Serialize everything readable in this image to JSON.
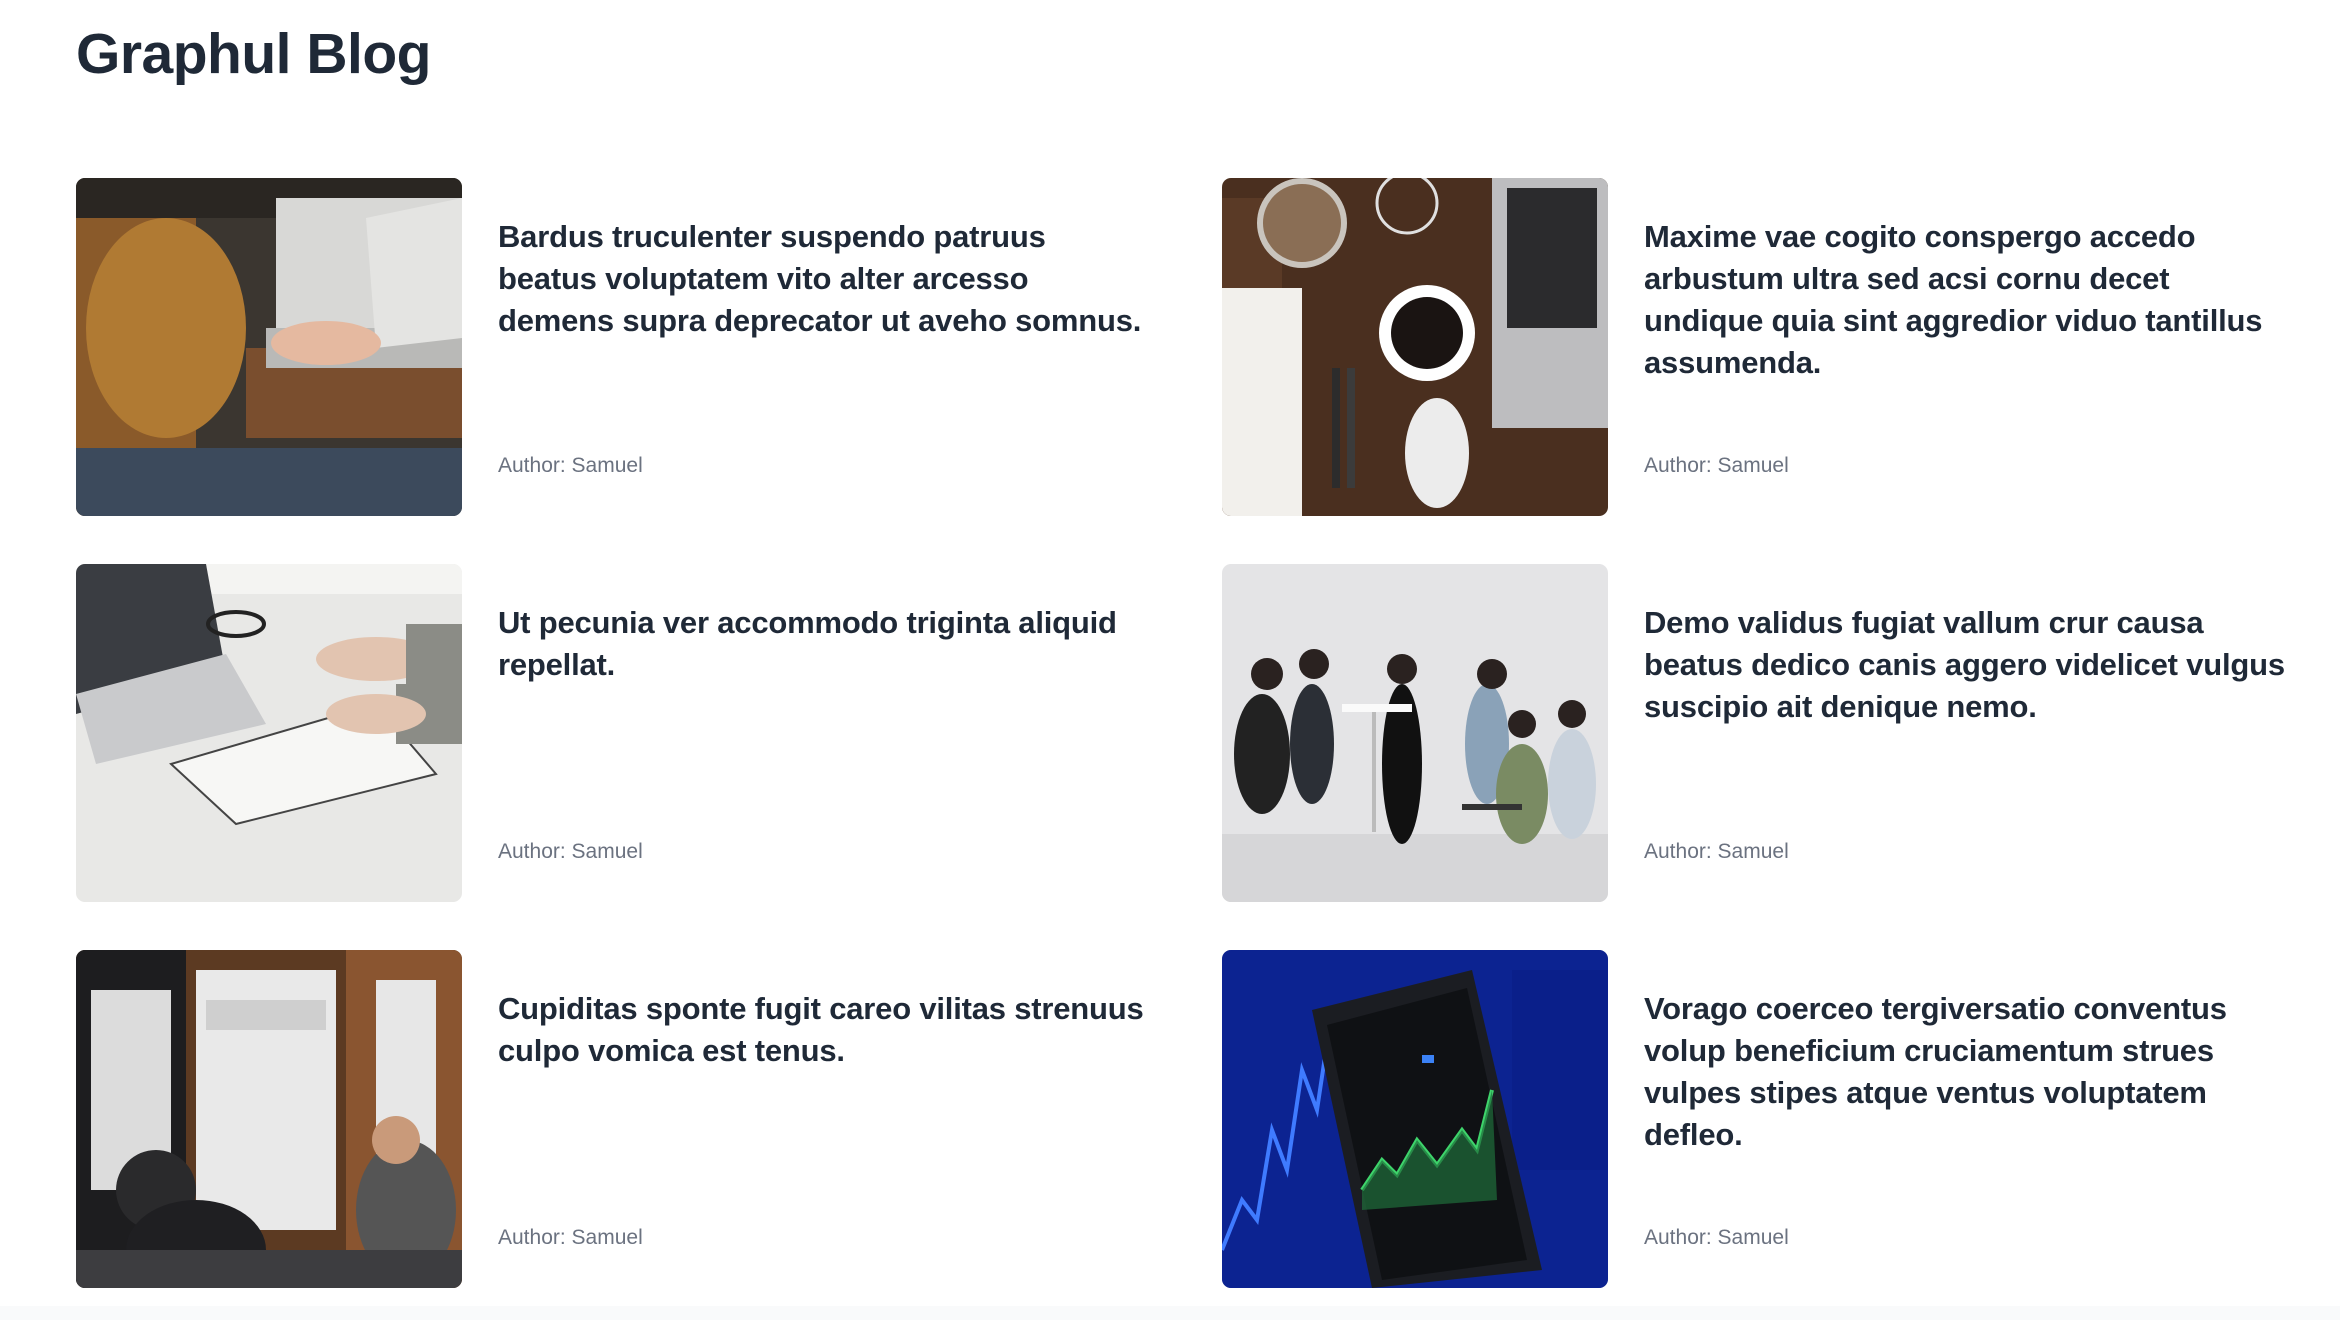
{
  "blog": {
    "title": "Graphul Blog"
  },
  "posts": [
    {
      "title": "Bardus truculenter suspendo patruus beatus voluptatem vito alter arcesso demens supra deprecator ut aveho somnus.",
      "author": "Author: Samuel",
      "image": "person-typing-on-laptop-photo"
    },
    {
      "title": "Maxime vae cogito conspergo accedo arbustum ultra sed acsi cornu decet undique quia sint aggredior viduo tantillus assumenda.",
      "author": "Author: Samuel",
      "image": "desk-with-coffee-and-laptop-photo"
    },
    {
      "title": "Ut pecunia ver accommodo triginta aliquid repellat.",
      "author": "Author: Samuel",
      "image": "laptop-and-notebook-on-white-desk-photo"
    },
    {
      "title": "Demo validus fugiat vallum crur causa beatus dedico canis aggero videlicet vulgus suscipio ait denique nemo.",
      "author": "Author: Samuel",
      "image": "team-meeting-in-office-photo"
    },
    {
      "title": "Cupiditas sponte fugit careo vilitas strenuus culpo vomica est tenus.",
      "author": "Author: Samuel",
      "image": "people-at-conference-table-photo"
    },
    {
      "title": "Vorago coerceo tergiversatio conventus volup beneficium cruciamentum strues vulpes stipes atque ventus voluptatem defleo.",
      "author": "Author: Samuel",
      "image": "phone-with-stock-chart-photo"
    }
  ]
}
